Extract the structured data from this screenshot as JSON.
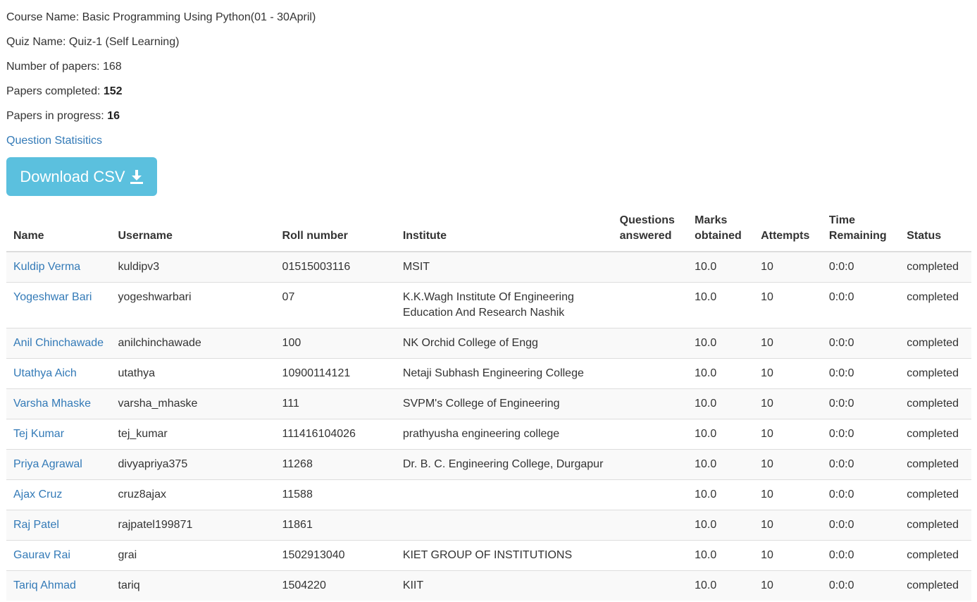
{
  "summary": {
    "course": "Course Name: Basic Programming Using Python(01 - 30April)",
    "quiz": "Quiz Name: Quiz-1 (Self Learning)",
    "papers_label": "Number of papers: 168",
    "completed_label": "Papers completed: ",
    "completed_value": "152",
    "progress_label": "Papers in progress: ",
    "progress_value": "16",
    "stats_link": "Question Statisitics"
  },
  "download": {
    "label": "Download CSV",
    "icon": "download-icon",
    "color": "#5bc0de"
  },
  "table": {
    "headers": {
      "name": "Name",
      "username": "Username",
      "roll": "Roll number",
      "institute": "Institute",
      "questions_1": "Questions",
      "questions_2": "answered",
      "marks_1": "Marks",
      "marks_2": "obtained",
      "attempts": "Attempts",
      "time_1": "Time",
      "time_2": "Remaining",
      "status": "Status"
    },
    "rows": [
      {
        "name": "Kuldip Verma",
        "username": "kuldipv3",
        "roll": "01515003116",
        "institute": "MSIT",
        "answered": "",
        "marks": "10.0",
        "attempts": "10",
        "time": "0:0:0",
        "status": "completed"
      },
      {
        "name": "Yogeshwar Bari",
        "username": "yogeshwarbari",
        "roll": "07",
        "institute": "K.K.Wagh Institute Of Engineering Education And Research Nashik",
        "answered": "",
        "marks": "10.0",
        "attempts": "10",
        "time": "0:0:0",
        "status": "completed"
      },
      {
        "name": "Anil Chinchawade",
        "username": "anilchinchawade",
        "roll": "100",
        "institute": "NK Orchid College of Engg",
        "answered": "",
        "marks": "10.0",
        "attempts": "10",
        "time": "0:0:0",
        "status": "completed"
      },
      {
        "name": "Utathya Aich",
        "username": "utathya",
        "roll": "10900114121",
        "institute": "Netaji Subhash Engineering College",
        "answered": "",
        "marks": "10.0",
        "attempts": "10",
        "time": "0:0:0",
        "status": "completed"
      },
      {
        "name": "Varsha Mhaske",
        "username": "varsha_mhaske",
        "roll": "111",
        "institute": "SVPM's College of Engineering",
        "answered": "",
        "marks": "10.0",
        "attempts": "10",
        "time": "0:0:0",
        "status": "completed"
      },
      {
        "name": "Tej Kumar",
        "username": "tej_kumar",
        "roll": "111416104026",
        "institute": "prathyusha engineering college",
        "answered": "",
        "marks": "10.0",
        "attempts": "10",
        "time": "0:0:0",
        "status": "completed"
      },
      {
        "name": "Priya Agrawal",
        "username": "divyapriya375",
        "roll": "11268",
        "institute": "Dr. B. C. Engineering College, Durgapur",
        "answered": "",
        "marks": "10.0",
        "attempts": "10",
        "time": "0:0:0",
        "status": "completed"
      },
      {
        "name": "Ajax Cruz",
        "username": "cruz8ajax",
        "roll": "11588",
        "institute": "",
        "answered": "",
        "marks": "10.0",
        "attempts": "10",
        "time": "0:0:0",
        "status": "completed"
      },
      {
        "name": "Raj Patel",
        "username": "rajpatel199871",
        "roll": "11861",
        "institute": "",
        "answered": "",
        "marks": "10.0",
        "attempts": "10",
        "time": "0:0:0",
        "status": "completed"
      },
      {
        "name": "Gaurav Rai",
        "username": "grai",
        "roll": "1502913040",
        "institute": "KIET GROUP OF INSTITUTIONS",
        "answered": "",
        "marks": "10.0",
        "attempts": "10",
        "time": "0:0:0",
        "status": "completed"
      },
      {
        "name": "Tariq Ahmad",
        "username": "tariq",
        "roll": "1504220",
        "institute": "KIIT",
        "answered": "",
        "marks": "10.0",
        "attempts": "10",
        "time": "0:0:0",
        "status": "completed"
      }
    ]
  }
}
